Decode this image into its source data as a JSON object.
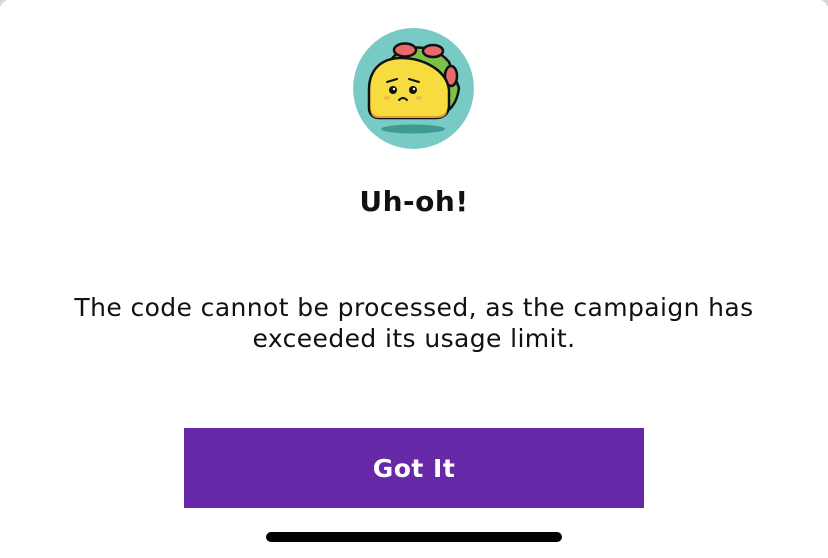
{
  "dialog": {
    "title": "Uh-oh!",
    "message": "The code cannot be processed, as the campaign has exceeded its usage limit.",
    "primary_button_label": "Got It",
    "illustration": "sad-taco-icon"
  },
  "colors": {
    "accent": "#6628a7",
    "illustration_bg": "#78cbc4",
    "taco_shell": "#f7dc3f",
    "text": "#111111"
  }
}
